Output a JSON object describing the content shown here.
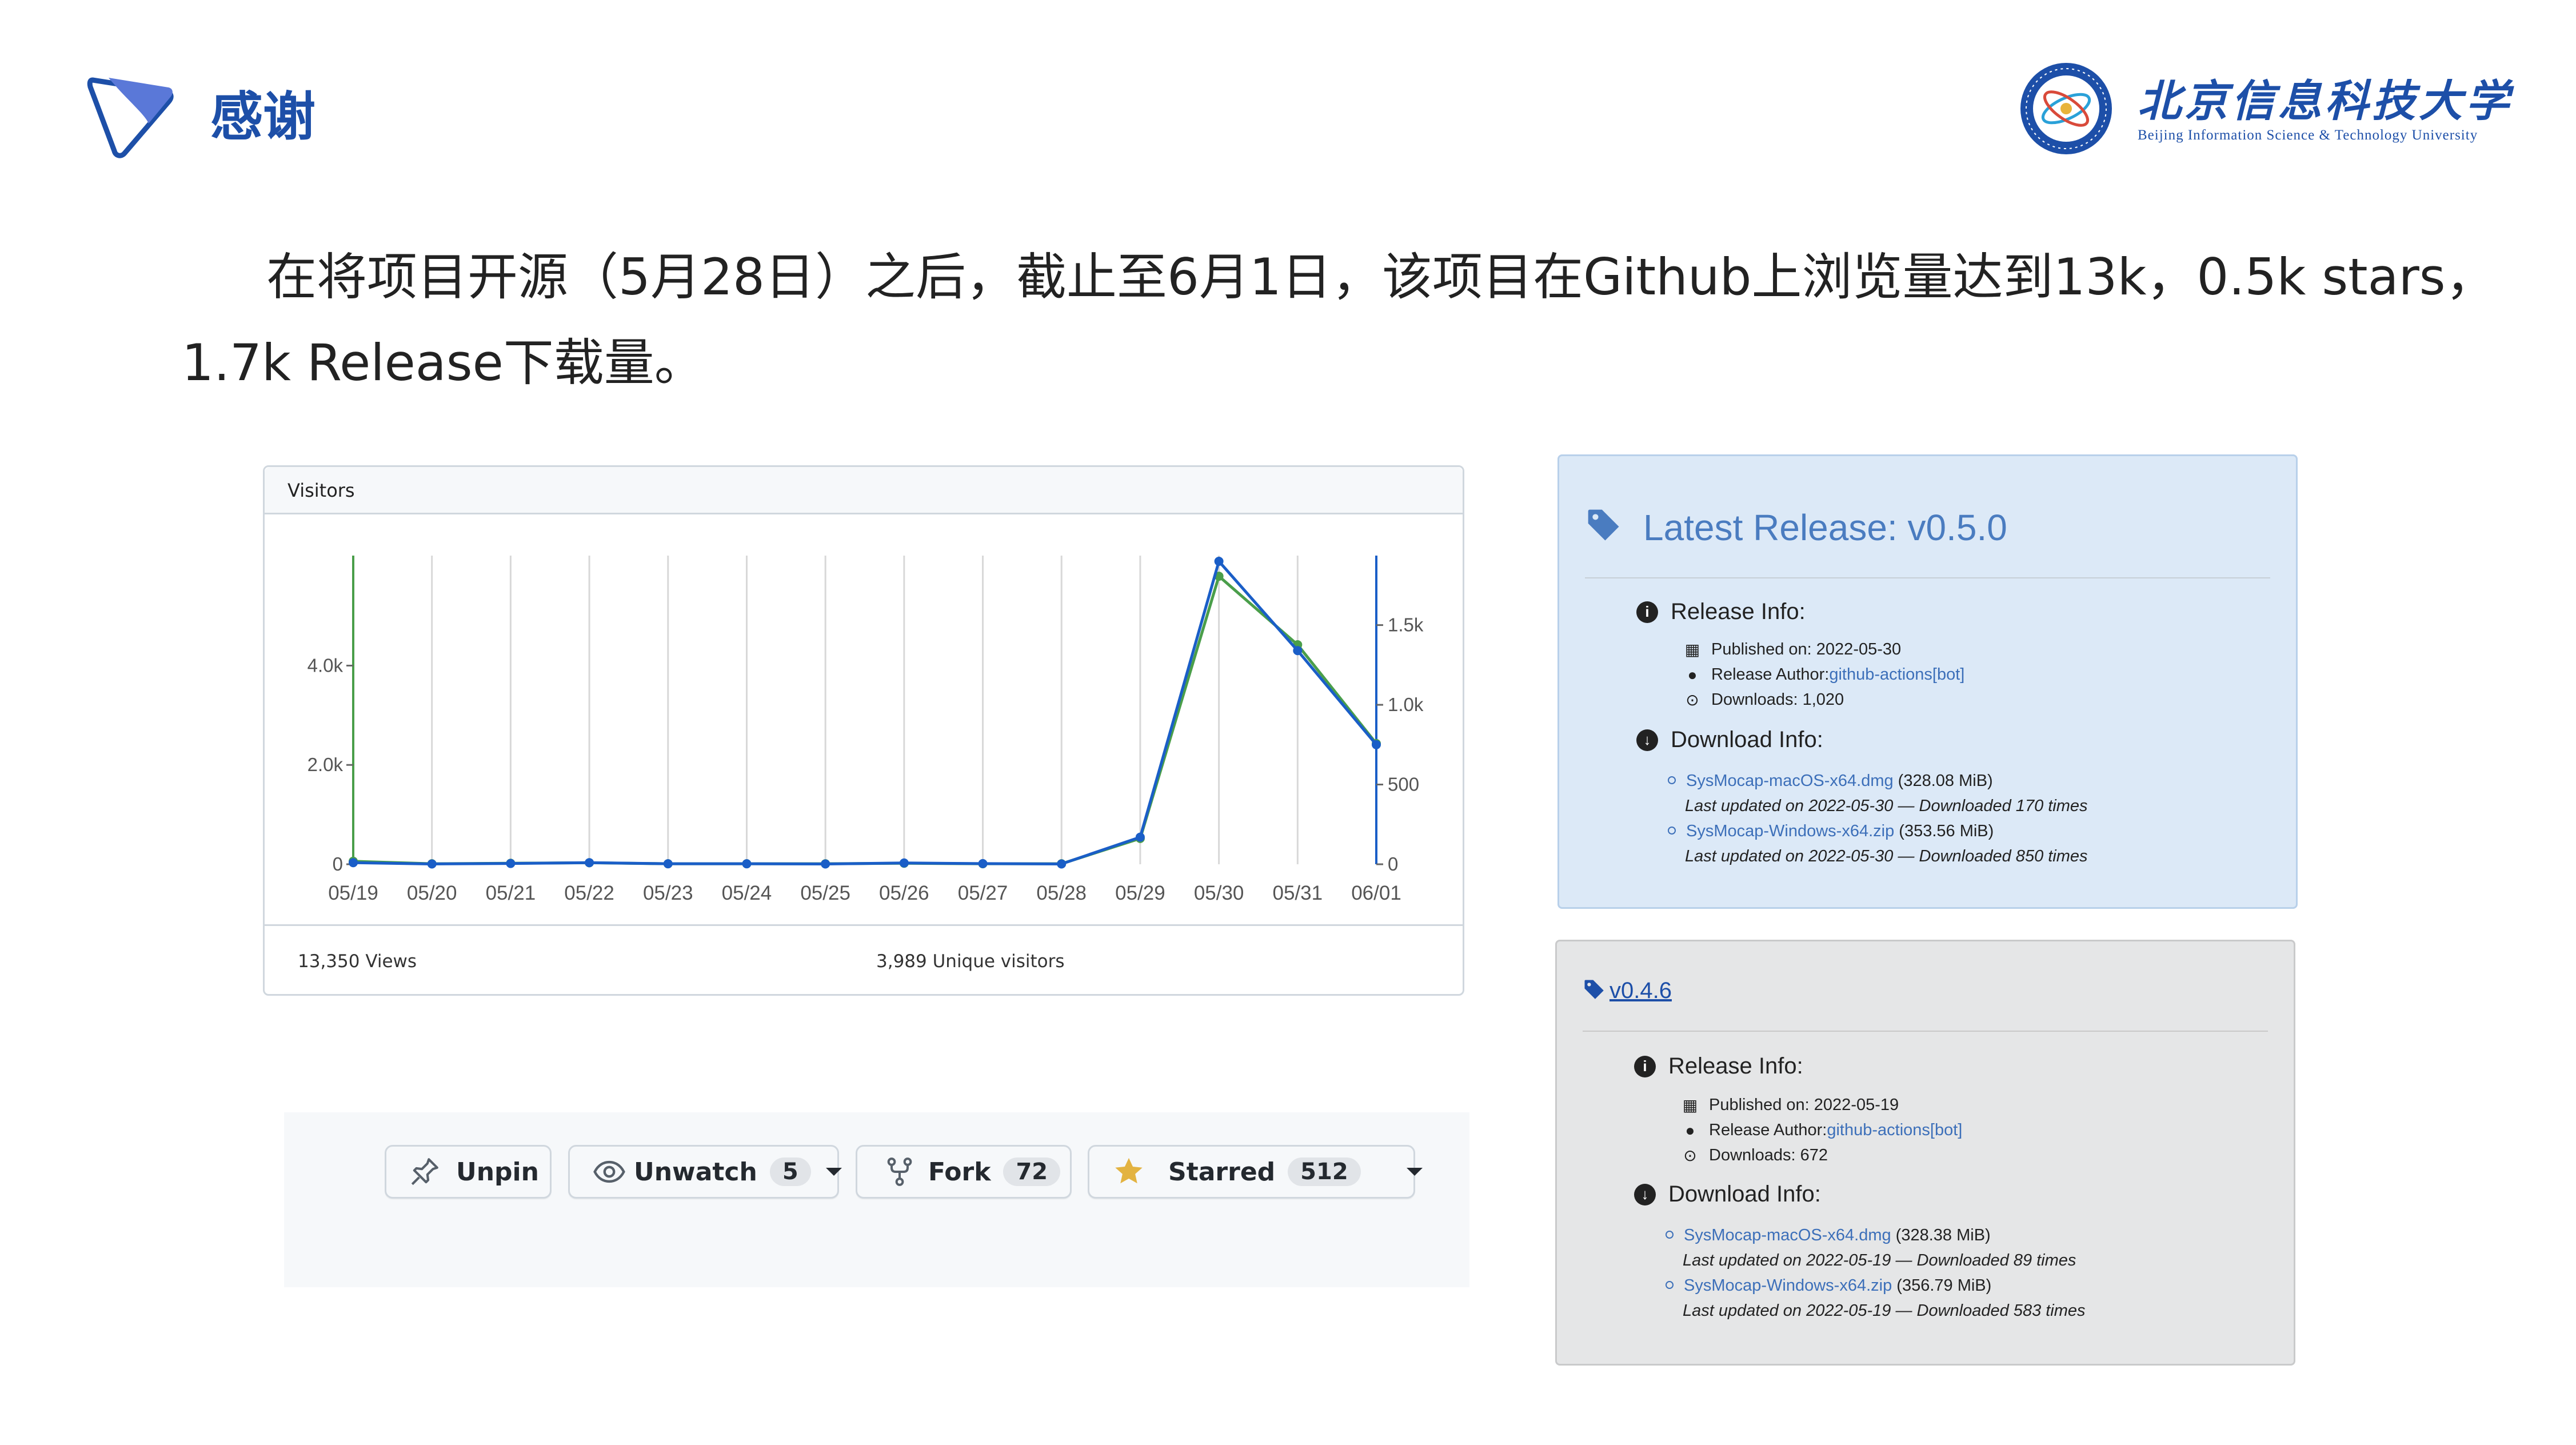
{
  "slide": {
    "title": "感谢",
    "university_name_cn": "北京信息科技大学",
    "university_name_en": "Beijing Information Science & Technology University",
    "paragraph_line1": "在将项目开源（5月28日）之后，截止至6月1日，该项目在Github上浏览量达到13k，0.5k  stars，",
    "paragraph_line2": "1.7k Release下载量。"
  },
  "visitors": {
    "header": "Visitors",
    "views_label": "13,350 Views",
    "uniques_label": "3,989 Unique visitors"
  },
  "chart_data": {
    "type": "line",
    "x": [
      "05/19",
      "05/20",
      "05/21",
      "05/22",
      "05/23",
      "05/24",
      "05/25",
      "05/26",
      "05/27",
      "05/28",
      "05/29",
      "05/30",
      "05/31",
      "06/01"
    ],
    "left_axis": {
      "ticks": [
        "0",
        "2.0k",
        "4.0k"
      ],
      "tick_values": [
        0,
        2000,
        4000
      ],
      "ylim": [
        0,
        6100
      ]
    },
    "right_axis": {
      "ticks": [
        "0",
        "500",
        "1.0k",
        "1.5k"
      ],
      "tick_values": [
        0,
        500,
        1000,
        1500
      ],
      "ylim": [
        0,
        1900
      ]
    },
    "series": [
      {
        "color": "#4a9e4a",
        "axis": "left",
        "values": [
          60,
          10,
          20,
          30,
          10,
          10,
          10,
          20,
          10,
          10,
          520,
          5800,
          4420,
          2430
        ]
      },
      {
        "color": "#1a5ec7",
        "axis": "right",
        "values": [
          10,
          2,
          5,
          10,
          3,
          3,
          2,
          8,
          4,
          2,
          170,
          1900,
          1340,
          750
        ]
      }
    ],
    "grid": "vertical"
  },
  "actions": {
    "unpin": "Unpin",
    "unwatch": "Unwatch",
    "unwatch_count": "5",
    "fork": "Fork",
    "fork_count": "72",
    "starred": "Starred",
    "starred_count": "512"
  },
  "release_latest": {
    "title": "Latest Release: v0.5.0",
    "release_info": "Release Info:",
    "published": "Published on: 2022-05-30",
    "author_label": "Release Author: ",
    "author_link": "github-actions[bot]",
    "downloads": "Downloads: 1,020",
    "download_info": "Download Info:",
    "file1": "SysMocap-macOS-x64.dmg",
    "file1_size": " (328.08 MiB)",
    "file1_note": "Last updated on 2022-05-30 — Downloaded 170 times",
    "file2": "SysMocap-Windows-x64.zip",
    "file2_size": " (353.56 MiB)",
    "file2_note": "Last updated on 2022-05-30 — Downloaded 850 times"
  },
  "release_old": {
    "title": " v0.4.6",
    "release_info": "Release Info:",
    "published": "Published on: 2022-05-19",
    "author_label": "Release Author: ",
    "author_link": "github-actions[bot]",
    "downloads": "Downloads: 672",
    "download_info": "Download Info:",
    "file1": "SysMocap-macOS-x64.dmg",
    "file1_size": " (328.38 MiB)",
    "file1_note": "Last updated on 2022-05-19 — Downloaded 89 times",
    "file2": "SysMocap-Windows-x64.zip",
    "file2_size": " (356.79 MiB)",
    "file2_note": "Last updated on 2022-05-19 — Downloaded 583 times"
  },
  "colors": {
    "brand_blue": "#1d4fa8",
    "chart_green": "#4a9e4a",
    "chart_blue": "#1a5ec7",
    "star_yellow": "#e3b341"
  }
}
